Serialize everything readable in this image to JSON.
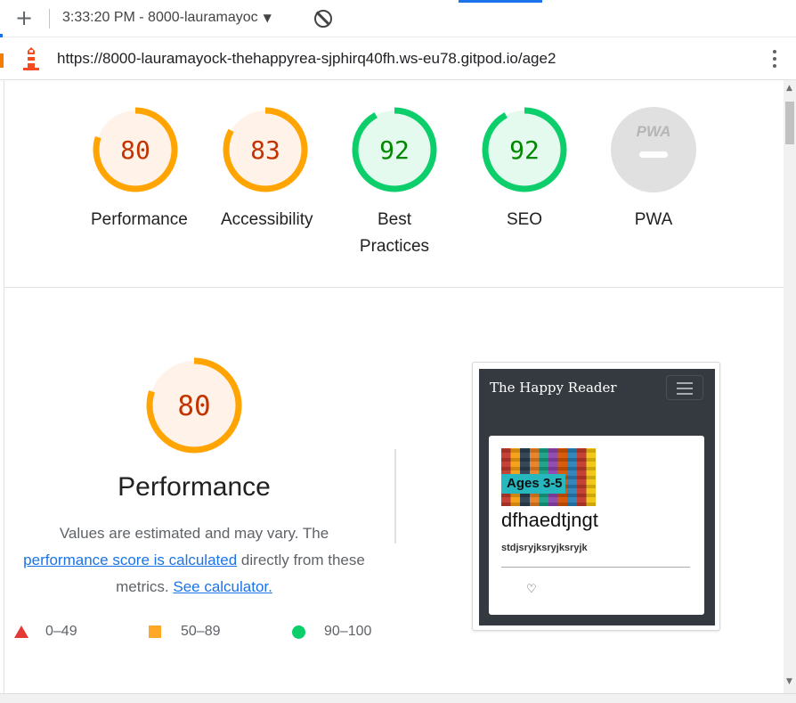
{
  "browser": {
    "tab_time": "3:33:20 PM - 8000-lauramayoc",
    "url": "https://8000-lauramayock-thehappyrea-sjphirq40fh.ws-eu78.gitpod.io/age2"
  },
  "scores": [
    {
      "value": "80",
      "label": "Performance",
      "status": "average"
    },
    {
      "value": "83",
      "label": "Accessibility",
      "status": "average"
    },
    {
      "value": "92",
      "label": "Best Practices",
      "status": "pass"
    },
    {
      "value": "92",
      "label": "SEO",
      "status": "pass"
    },
    {
      "value": "PWA",
      "label": "PWA",
      "status": "na"
    }
  ],
  "performance": {
    "score": "80",
    "title": "Performance",
    "desc_text": "Values are estimated and may vary. The",
    "link_score_calc": "performance score is calculated",
    "desc_middle": "directly from these metrics.",
    "link_calculator": "See calculator."
  },
  "legend": {
    "fail": "0–49",
    "average": "50–89",
    "pass": "90–100"
  },
  "screenshot": {
    "brand": "The Happy Reader",
    "badge": "Ages 3-5",
    "card_title": "dfhaedtjngt",
    "card_text": "stdjsryjksryjksryjk",
    "heart_icon": "♡"
  },
  "colors": {
    "average": "#ffa400",
    "average_bg": "#fff3e9",
    "average_text": "#c33300",
    "pass": "#0cce6b",
    "pass_bg": "#e5faef",
    "pass_text": "#008800",
    "link": "#1a73e8"
  }
}
